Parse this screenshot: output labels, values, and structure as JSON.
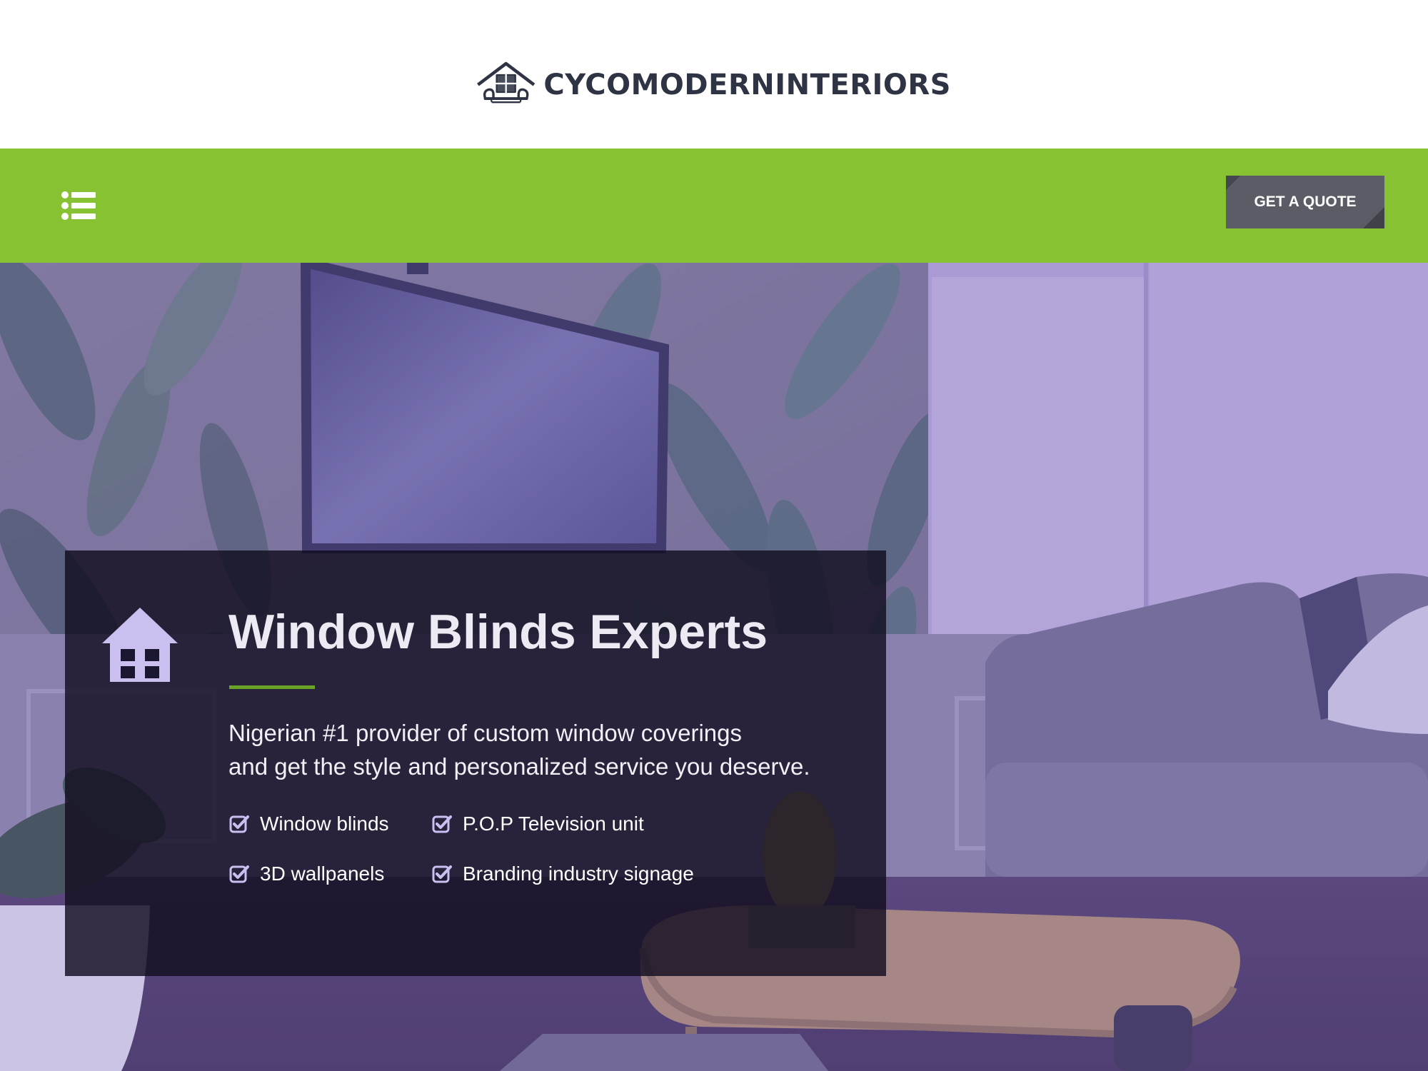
{
  "header": {
    "brand_name": "CYCOMODERNINTERIORS",
    "logo_icon": "house-sofa-logo-icon",
    "brand_color": "#2f3445"
  },
  "nav": {
    "menu_icon": "list-menu-icon",
    "quote_button_label": "GET A QUOTE",
    "bar_color": "#86c232",
    "button_color": "#5a5d66"
  },
  "hero": {
    "icon": "house-icon",
    "title": "Window Blinds Experts",
    "description_lines": [
      "Nigerian #1 provider of custom window coverings",
      "and get the style and personalized service you deserve."
    ],
    "features": [
      "Window blinds",
      "P.O.P Television unit",
      "3D wallpanels",
      "Branding industry signage"
    ],
    "feature_icon": "check-square-icon",
    "accent_color": "#6aa225",
    "overlay_tint": "#a99ad6"
  }
}
